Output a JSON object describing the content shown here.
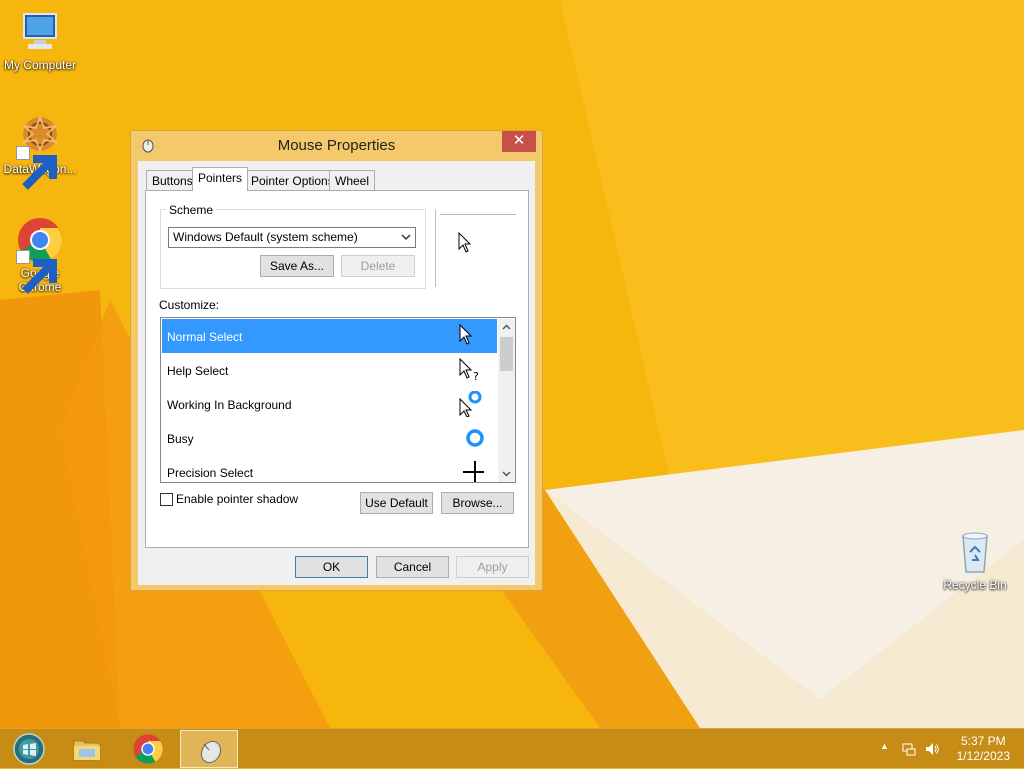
{
  "desktop": {
    "icons": [
      {
        "label": "My Computer",
        "icon": "computer-icon"
      },
      {
        "label": "DataWagon...",
        "icon": "datawagon-icon"
      },
      {
        "label_line1": "Google",
        "label_line2": "Chrome",
        "icon": "chrome-icon"
      },
      {
        "label": "Recycle Bin",
        "icon": "recycle-bin-icon"
      }
    ]
  },
  "dialog": {
    "title": "Mouse Properties",
    "close_glyph": "✕",
    "tabs": [
      "Buttons",
      "Pointers",
      "Pointer Options",
      "Wheel"
    ],
    "active_tab": "Pointers",
    "scheme": {
      "group_label": "Scheme",
      "selected": "Windows Default (system scheme)",
      "save_as_label": "Save As...",
      "delete_label": "Delete"
    },
    "customize_label": "Customize:",
    "cursors": [
      {
        "label": "Normal Select",
        "icon": "arrow-cursor-icon",
        "selected": true
      },
      {
        "label": "Help Select",
        "icon": "help-cursor-icon",
        "selected": false
      },
      {
        "label": "Working In Background",
        "icon": "working-cursor-icon",
        "selected": false
      },
      {
        "label": "Busy",
        "icon": "busy-cursor-icon",
        "selected": false
      },
      {
        "label": "Precision Select",
        "icon": "crosshair-cursor-icon",
        "selected": false
      }
    ],
    "enable_shadow_label": "Enable pointer shadow",
    "enable_shadow_checked": false,
    "use_default_label": "Use Default",
    "browse_label": "Browse...",
    "ok_label": "OK",
    "cancel_label": "Cancel",
    "apply_label": "Apply"
  },
  "taskbar": {
    "clock_time": "5:37 PM",
    "clock_date": "1/12/2023",
    "tray_arrow": "▲"
  },
  "colors": {
    "desktop_bg": "#f5b710",
    "selection": "#3399ff",
    "taskbar": "#c78c15"
  }
}
